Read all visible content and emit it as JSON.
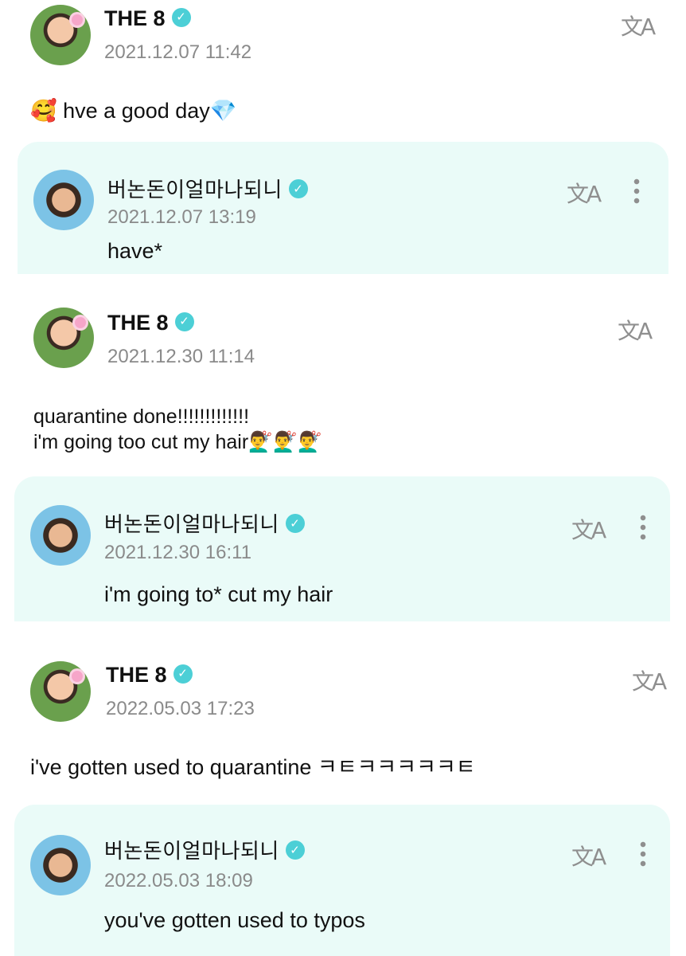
{
  "threads": [
    {
      "post": {
        "author": "THE 8",
        "verified_mark": "✓",
        "timestamp": "2021.12.07 11:42",
        "lead_emoji": "🥰",
        "text": "hve a good day",
        "trail_emoji": "💎",
        "translate_icon": "translate-icon"
      },
      "reply": {
        "author": "버논돈이얼마나되니",
        "verified_mark": "✓",
        "timestamp": "2021.12.07 13:19",
        "text": "have*"
      }
    },
    {
      "post": {
        "author": "THE 8",
        "verified_mark": "✓",
        "timestamp": "2021.12.30 11:14",
        "line1": "quarantine done!!!!!!!!!!!!!",
        "line2": "i'm going too cut my hair",
        "line2_emoji": "💇‍♂️💇‍♂️💇‍♂️"
      },
      "reply": {
        "author": "버논돈이얼마나되니",
        "verified_mark": "✓",
        "timestamp": "2021.12.30 16:11",
        "text": "i'm going to* cut my hair"
      }
    },
    {
      "post": {
        "author": "THE 8",
        "verified_mark": "✓",
        "timestamp": "2022.05.03 17:23",
        "text": "i've gotten used to quarantine ㅋㅌㅋㅋㅋㅋㅋㅌ"
      },
      "reply": {
        "author": "버논돈이얼마나되니",
        "verified_mark": "✓",
        "timestamp": "2022.05.03 18:09",
        "text": "you've gotten used to typos"
      }
    }
  ],
  "icons": {
    "translate": "文A",
    "more": "more-vertical-icon"
  },
  "colors": {
    "reply_bg": "#eafbf8",
    "badge": "#4ccfd6",
    "timestamp": "#8a8a8a"
  }
}
